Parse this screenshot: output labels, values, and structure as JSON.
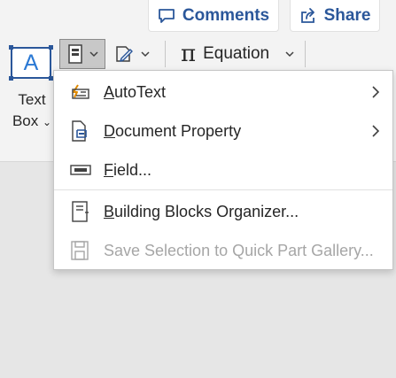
{
  "header": {
    "comments_label": "Comments",
    "share_label": "Share"
  },
  "ribbon": {
    "textbox_icon_letter": "A",
    "textbox_label_line1": "Text",
    "textbox_label_line2": "Box",
    "equation_symbol": "π",
    "equation_label": "Equation"
  },
  "menu": {
    "items": [
      {
        "accel": "A",
        "rest": "utoText",
        "icon": "autotext-icon",
        "submenu": true,
        "enabled": true
      },
      {
        "accel": "D",
        "rest": "ocument Property",
        "icon": "document-property-icon",
        "submenu": true,
        "enabled": true
      },
      {
        "accel": "F",
        "rest": "ield...",
        "icon": "field-icon",
        "submenu": false,
        "enabled": true
      },
      {
        "accel": "B",
        "rest": "uilding Blocks Organizer...",
        "icon": "building-blocks-icon",
        "submenu": false,
        "enabled": true
      },
      {
        "accel": "",
        "rest": "Save Selection to Quick Part Gallery...",
        "icon": "save-selection-icon",
        "submenu": false,
        "enabled": false
      }
    ]
  },
  "colors": {
    "accent": "#2b579a",
    "ribbon_bg": "#f3f3f3",
    "canvas_bg": "#e6e6e6",
    "disabled_text": "#a6a6a6"
  }
}
